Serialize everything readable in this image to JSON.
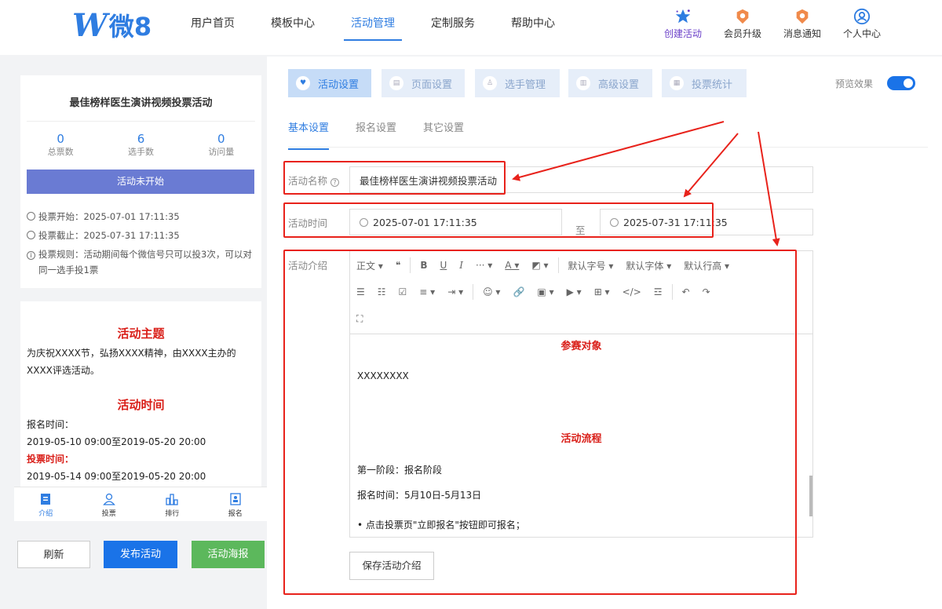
{
  "brand": {
    "logo_text": "微8"
  },
  "nav": [
    "用户首页",
    "模板中心",
    "活动管理",
    "定制服务",
    "帮助中心"
  ],
  "tools": [
    "创建活动",
    "会员升级",
    "消息通知",
    "个人中心"
  ],
  "activity": {
    "title": "最佳榜样医生演讲视频投票活动",
    "stats": [
      {
        "value": "0",
        "label": "总票数"
      },
      {
        "value": "6",
        "label": "选手数"
      },
      {
        "value": "0",
        "label": "访问量"
      }
    ],
    "status": "活动未开始",
    "vote_start": "投票开始：2025-07-01 17:11:35",
    "vote_end": "投票截止：2025-07-31 17:11:35",
    "vote_rule": "投票规则：活动期间每个微信号只可以投3次，可以对同一选手投1票"
  },
  "preview_content": {
    "theme_heading": "活动主题",
    "theme_text": "为庆祝XXXX节，弘扬XXXX精神，由XXXX主办的XXXX评选活动。",
    "time_heading": "活动时间",
    "signup_label": "报名时间：",
    "signup_time": "2019-05-10 09:00至2019-05-20 20:00",
    "vote_label": "投票时间：",
    "vote_time": "2019-05-14 09:00至2019-05-20 20:00"
  },
  "mobile_tabs": [
    "介绍",
    "投票",
    "排行",
    "报名"
  ],
  "buttons": {
    "refresh": "刷新",
    "publish": "发布活动",
    "poster": "活动海报"
  },
  "step_tabs": [
    "活动设置",
    "页面设置",
    "选手管理",
    "高级设置",
    "投票统计"
  ],
  "preview_label": "预览效果",
  "sub_tabs": [
    "基本设置",
    "报名设置",
    "其它设置"
  ],
  "form": {
    "name_label": "活动名称",
    "name_value": "最佳榜样医生演讲视频投票活动",
    "time_label": "活动时间",
    "start_time": "2025-07-01 17:11:35",
    "to_label": "至",
    "end_time": "2025-07-31 17:11:35",
    "intro_label": "活动介绍",
    "save_label": "保存活动介绍"
  },
  "editor": {
    "toolbar1": [
      "正文 ▾",
      "❝",
      "B",
      "U",
      "I",
      "··· ▾",
      "A ▾",
      "◩ ▾",
      "默认字号 ▾",
      "默认字体 ▾",
      "默认行高 ▾"
    ],
    "toolbar2": [
      "☰",
      "☷",
      "☑",
      "≡ ▾",
      "⇥ ▾",
      "☺ ▾",
      "🔗",
      "▣ ▾",
      "▶ ▾",
      "⊞ ▾",
      "</>",
      "☲",
      "↶",
      "↷"
    ],
    "toolbar3": [
      "⛶"
    ],
    "heading1": "参赛对象",
    "text1": "XXXXXXXX",
    "heading2": "活动流程",
    "stage": "第一阶段：报名阶段",
    "signup": "报名时间：5月10日-5月13日",
    "bullet": "• 点击投票页\"立即报名\"按钮即可报名；"
  },
  "colors": {
    "accent": "#2f7de1",
    "annotation": "#e8221b",
    "status_button": "#6a7bd3",
    "publish": "#1a73e8",
    "poster": "#5cb85c"
  }
}
